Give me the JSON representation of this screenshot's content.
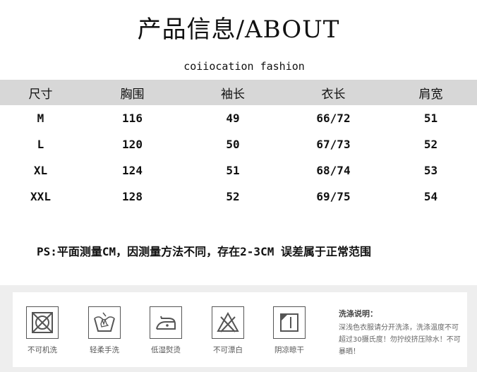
{
  "title": "产品信息/ABOUT",
  "subtitle": "coiiocation fashion",
  "table": {
    "headers": [
      "尺寸",
      "胸围",
      "袖长",
      "衣长",
      "肩宽"
    ],
    "rows": [
      [
        "M",
        "116",
        "49",
        "66/72",
        "51"
      ],
      [
        "L",
        "120",
        "50",
        "67/73",
        "52"
      ],
      [
        "XL",
        "124",
        "51",
        "68/74",
        "53"
      ],
      [
        "XXL",
        "128",
        "52",
        "69/75",
        "54"
      ]
    ]
  },
  "note": "PS:平面测量CM，因测量方法不同，存在2-3CM 误差属于正常范围",
  "care": {
    "icons": [
      {
        "icon": "no-machine-wash-icon",
        "label": "不可机洗"
      },
      {
        "icon": "gentle-hand-wash-icon",
        "label": "轻柔手洗"
      },
      {
        "icon": "low-temp-iron-icon",
        "label": "低湿熨烫"
      },
      {
        "icon": "no-bleach-icon",
        "label": "不可漂白"
      },
      {
        "icon": "shade-dry-icon",
        "label": "阴凉晾干"
      }
    ],
    "wash_title": "洗涤说明：",
    "wash_text": "深浅色衣服请分开洗涤，洗涤温度不可超过30摄氏度！勿拧绞挤压除水！不可暴晒！"
  }
}
